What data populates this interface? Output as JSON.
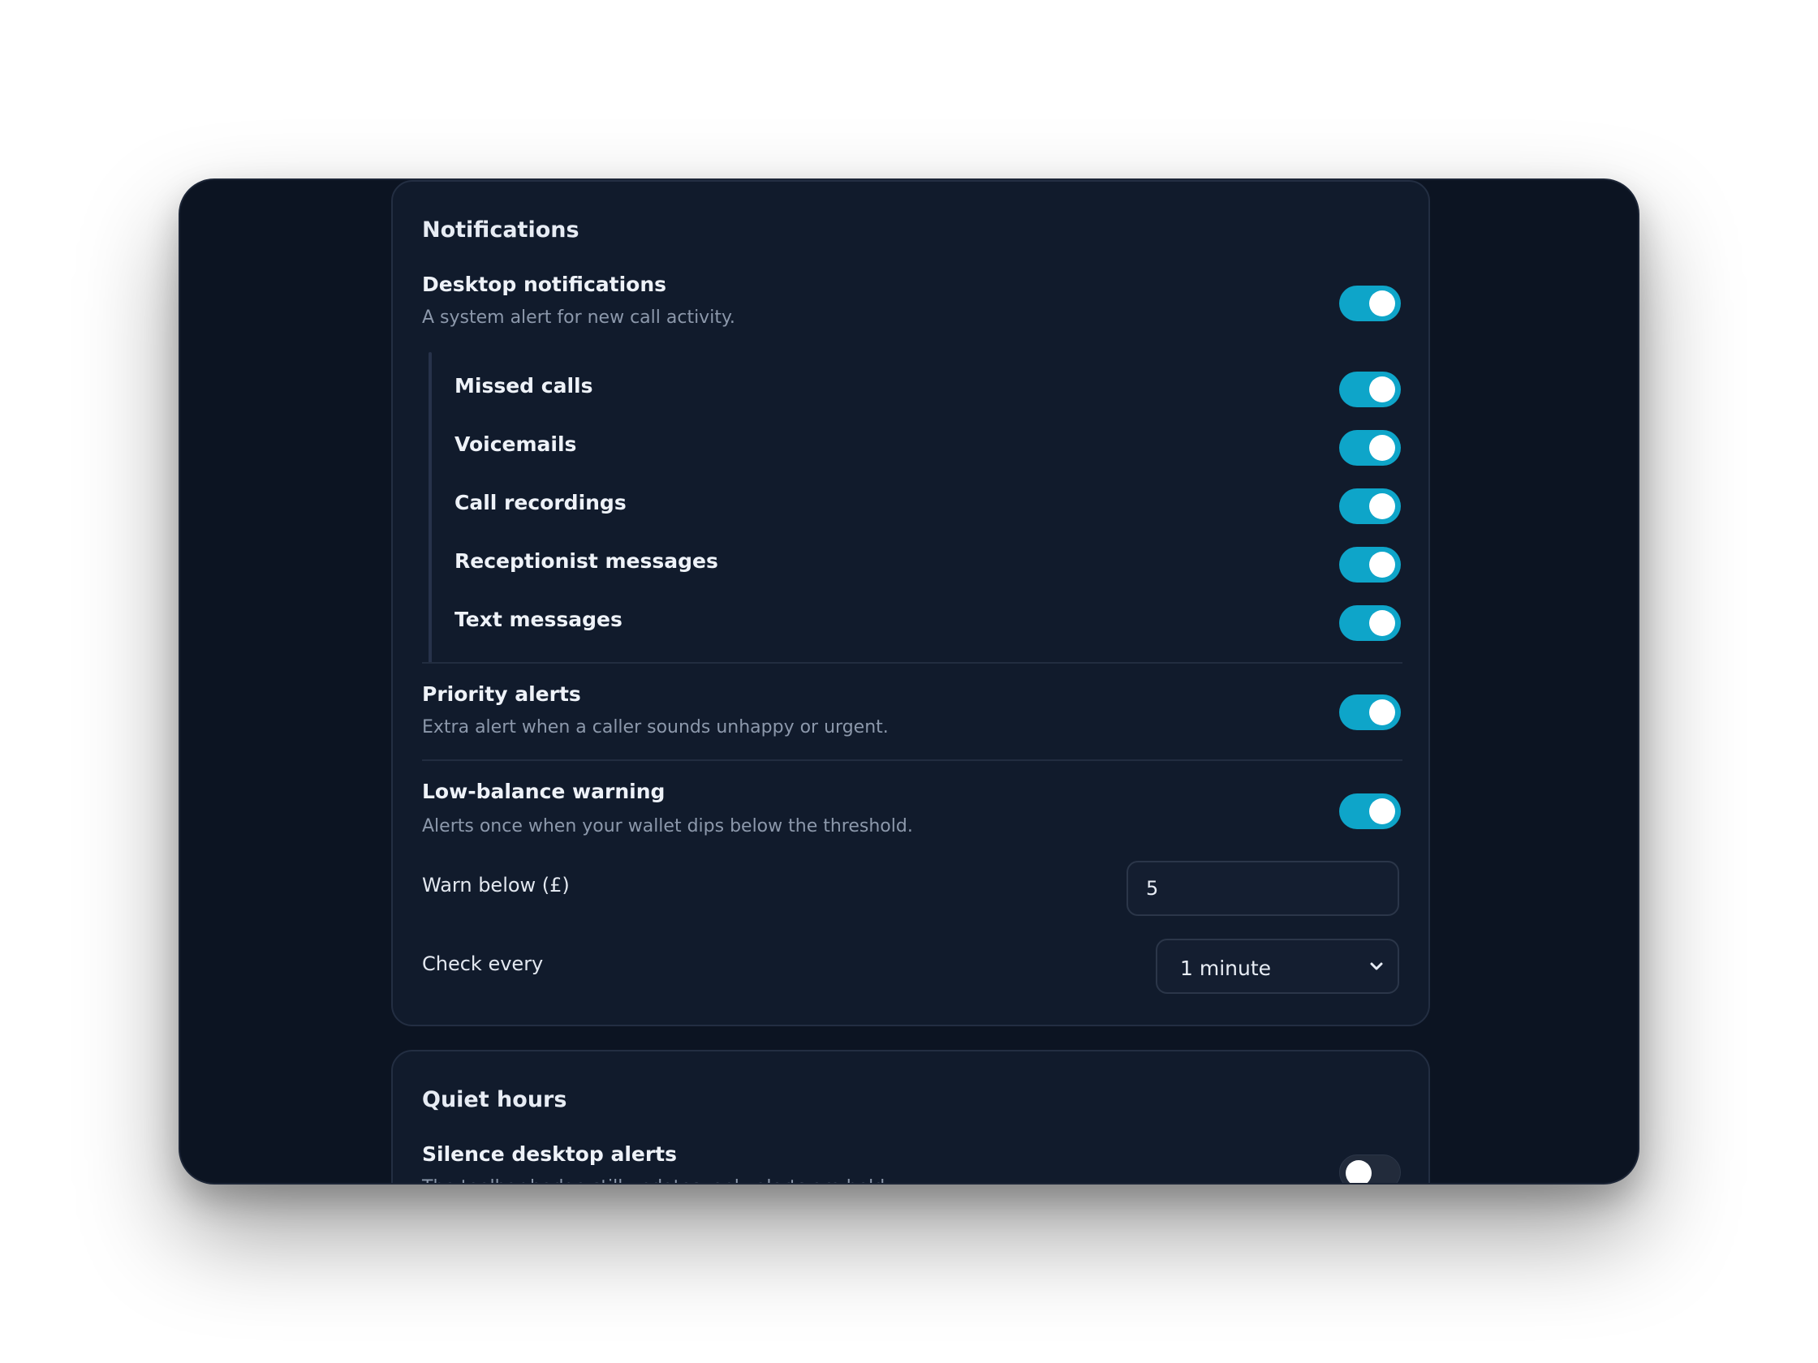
{
  "notifications": {
    "title": "Notifications",
    "desktop": {
      "title": "Desktop notifications",
      "desc": "A system alert for new call activity.",
      "enabled": true
    },
    "sub_items": [
      {
        "label": "Missed calls",
        "enabled": true
      },
      {
        "label": "Voicemails",
        "enabled": true
      },
      {
        "label": "Call recordings",
        "enabled": true
      },
      {
        "label": "Receptionist messages",
        "enabled": true
      },
      {
        "label": "Text messages",
        "enabled": true
      }
    ],
    "priority": {
      "title": "Priority alerts",
      "desc": "Extra alert when a caller sounds unhappy or urgent.",
      "enabled": true
    },
    "low_balance": {
      "title": "Low-balance warning",
      "desc": "Alerts once when your wallet dips below the threshold.",
      "enabled": true,
      "warn_label": "Warn below (£)",
      "warn_value": "5",
      "check_label": "Check every",
      "check_value": "1 minute"
    }
  },
  "quiet_hours": {
    "title": "Quiet hours",
    "silence": {
      "title": "Silence desktop alerts",
      "desc": "The toolbar badge still updates, only alerts are held.",
      "enabled": false
    }
  },
  "colors": {
    "accent": "#0ea5c9",
    "window_bg": "#0c1422",
    "card_bg": "#111b2c"
  }
}
